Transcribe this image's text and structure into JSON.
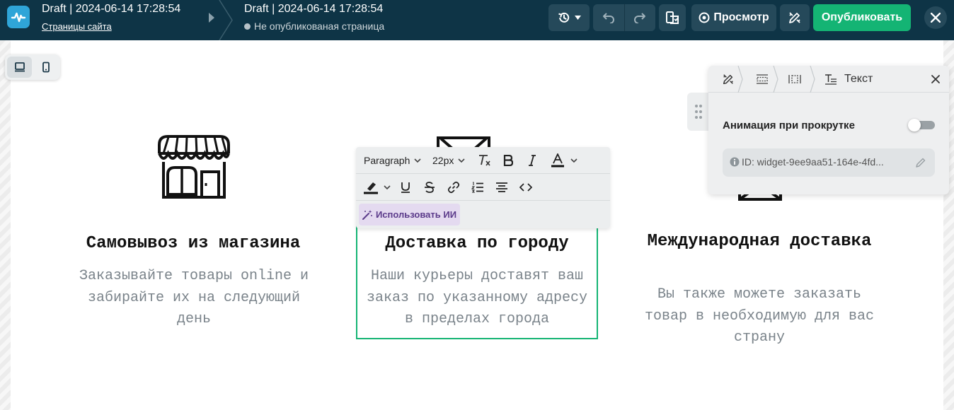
{
  "topbar": {
    "page_title": "Draft | 2024-06-14 17:28:54",
    "site_pages_link": "Страницы сайта",
    "draft_title": "Draft | 2024-06-14 17:28:54",
    "status_text": "Не опубликованая страница",
    "preview_label": "Просмотр",
    "publish_label": "Опубликовать"
  },
  "features": [
    {
      "title": "Самовывоз из магазина",
      "description": "Заказывайте товары online и забирайте их на следующий день",
      "icon": "store-icon"
    },
    {
      "title": "Доставка по городу",
      "description": "Наши курьеры доставят ваш заказ по указанному адресу в пределах города",
      "icon": "envelope-icon"
    },
    {
      "title": "Международная доставка",
      "description": "Вы также можете заказать товар в необходимую для вас страну",
      "icon": "envelope-icon"
    }
  ],
  "text_toolbar": {
    "block_type": "Paragraph",
    "font_size": "22px",
    "ai_button_label": "Использовать ИИ"
  },
  "settings_panel": {
    "title": "Текст",
    "scroll_animation_label": "Анимация при прокрутке",
    "scroll_animation_enabled": false,
    "widget_id_text": "ID: widget-9ee9aa51-164e-4fd..."
  },
  "colors": {
    "topbar_bg": "#0e3446",
    "button_bg": "#25495a",
    "publish_green": "#14b474",
    "selection_border": "#14b474",
    "ai_purple": "#5b3a8a"
  }
}
